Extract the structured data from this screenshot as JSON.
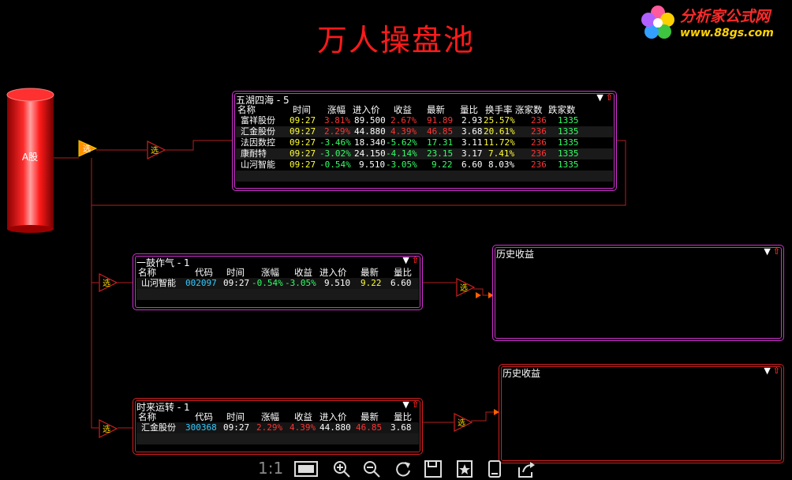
{
  "page": {
    "title": "万人操盘池"
  },
  "logo": {
    "text": "分析家公式网",
    "url": "www.88gs.com"
  },
  "source": {
    "label": "A股"
  },
  "colors": {
    "red": "#ff2020",
    "green": "#33ff66",
    "cyan": "#33ccff",
    "yellow": "#ffff33",
    "magenta": "#cc33cc",
    "frame_red": "#d02020"
  },
  "win1": {
    "title": "五湖四海 - 5",
    "headers": [
      "名称",
      "时间",
      "涨幅",
      "进入价",
      "收益",
      "最新",
      "量比",
      "换手率",
      "涨家数",
      "跌家数"
    ],
    "rows": [
      {
        "name": "富祥股份",
        "time": "09:27",
        "chg": "3.81%",
        "entry": "89.500",
        "gain": "2.67%",
        "last": "91.89",
        "vol": "2.93",
        "turn": "25.57%",
        "up": "236",
        "down": "1335"
      },
      {
        "name": "汇金股份",
        "time": "09:27",
        "chg": "2.29%",
        "entry": "44.880",
        "gain": "4.39%",
        "last": "46.85",
        "vol": "3.68",
        "turn": "20.61%",
        "up": "236",
        "down": "1335"
      },
      {
        "name": "法因数控",
        "time": "09:27",
        "chg": "-3.46%",
        "entry": "18.340",
        "gain": "-5.62%",
        "last": "17.31",
        "vol": "3.11",
        "turn": "11.72%",
        "up": "236",
        "down": "1335"
      },
      {
        "name": "康耐特",
        "time": "09:27",
        "chg": "-3.02%",
        "entry": "24.150",
        "gain": "-4.14%",
        "last": "23.15",
        "vol": "3.17",
        "turn": "7.41%",
        "up": "236",
        "down": "1335"
      },
      {
        "name": "山河智能",
        "time": "09:27",
        "chg": "-0.54%",
        "entry": "9.510",
        "gain": "-3.05%",
        "last": "9.22",
        "vol": "6.60",
        "turn": "8.03%",
        "up": "236",
        "down": "1335"
      }
    ]
  },
  "win2": {
    "title": "一鼓作气 - 1",
    "headers": [
      "名称",
      "代码",
      "时间",
      "涨幅",
      "收益",
      "进入价",
      "最新",
      "量比"
    ],
    "rows": [
      {
        "name": "山河智能",
        "code": "002097",
        "time": "09:27",
        "chg": "-0.54%",
        "gain": "-3.05%",
        "entry": "9.510",
        "last": "9.22",
        "vol": "6.60"
      }
    ]
  },
  "win3": {
    "title": "时来运转 - 1",
    "headers": [
      "名称",
      "代码",
      "时间",
      "涨幅",
      "收益",
      "进入价",
      "最新",
      "量比"
    ],
    "rows": [
      {
        "name": "汇金股份",
        "code": "300368",
        "time": "09:27",
        "chg": "2.29%",
        "gain": "4.39%",
        "entry": "44.880",
        "last": "46.85",
        "vol": "3.68"
      }
    ]
  },
  "hist1": {
    "title": "历史收益"
  },
  "hist2": {
    "title": "历史收益"
  },
  "ctrl": {
    "dropdown": "▼",
    "up": "⇧"
  },
  "toolbar": {
    "ratio": "1:1"
  },
  "filter_label": "选"
}
